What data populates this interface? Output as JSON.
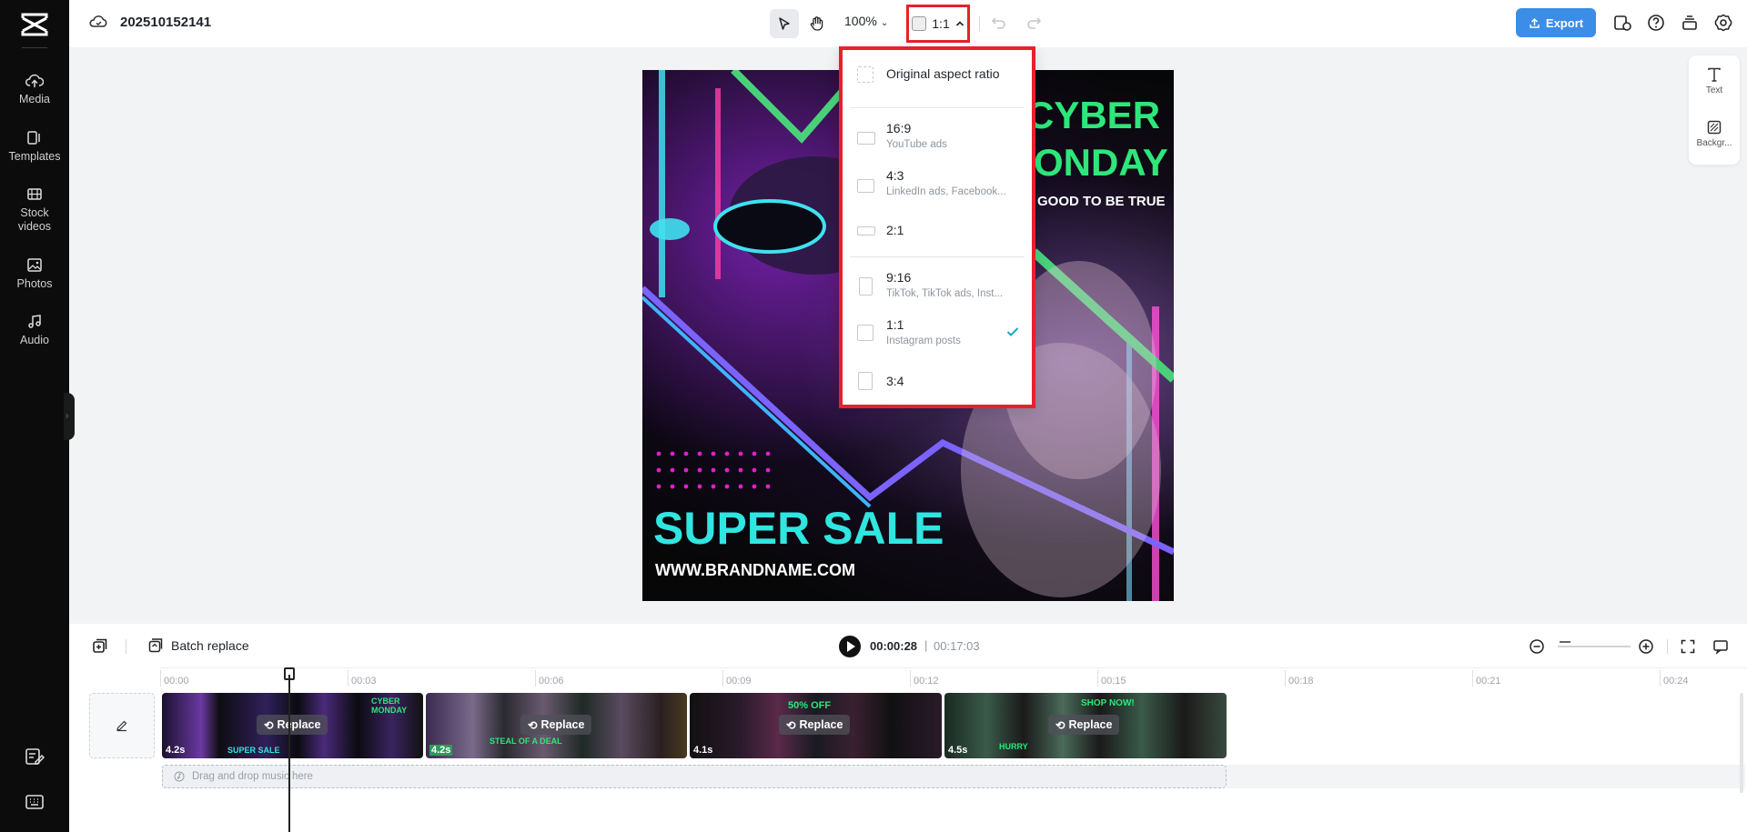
{
  "project": {
    "title": "202510152141"
  },
  "sidebar": {
    "items": [
      {
        "label": "Media",
        "icon": "cloud-upload-icon"
      },
      {
        "label": "Templates",
        "icon": "templates-icon"
      },
      {
        "label": "Stock\nvideos",
        "line1": "Stock",
        "line2": "videos",
        "icon": "stock-videos-icon"
      },
      {
        "label": "Photos",
        "icon": "photos-icon"
      },
      {
        "label": "Audio",
        "icon": "audio-icon"
      }
    ]
  },
  "toolbar": {
    "zoom": "100%",
    "ratio": "1:1",
    "export_label": "Export"
  },
  "right_panel": {
    "text_label": "Text",
    "background_label": "Backgr..."
  },
  "aspect_menu": {
    "items": [
      {
        "label": "Original aspect ratio",
        "sub": ""
      },
      {
        "label": "16:9",
        "sub": "YouTube ads"
      },
      {
        "label": "4:3",
        "sub": "LinkedIn ads, Facebook..."
      },
      {
        "label": "2:1",
        "sub": ""
      },
      {
        "label": "9:16",
        "sub": "TikTok, TikTok ads, Inst..."
      },
      {
        "label": "1:1",
        "sub": "Instagram posts",
        "selected": true
      },
      {
        "label": "3:4",
        "sub": ""
      }
    ]
  },
  "poster": {
    "headline1": "CYBER",
    "headline2": "ONDAY",
    "tagline": "GOOD TO BE TRUE",
    "sale": "SUPER SALE",
    "url": "WWW.BRANDNAME.COM"
  },
  "timeline": {
    "batch_replace": "Batch replace",
    "current_time": "00:00:28",
    "separator": "|",
    "total_time": "00:17:03",
    "ruler": [
      "00:00",
      "00:03",
      "00:06",
      "00:09",
      "00:12",
      "00:15",
      "00:18",
      "00:21",
      "00:24"
    ],
    "clips": [
      {
        "duration": "4.2s",
        "replace": "Replace",
        "t1": "CYBER MONDAY",
        "t2": "SUPER SALE"
      },
      {
        "duration": "4.2s",
        "replace": "Replace",
        "t1": "STEAL OF A DEAL",
        "t2": ""
      },
      {
        "duration": "4.1s",
        "replace": "Replace",
        "t1": "50% OFF",
        "t2": ""
      },
      {
        "duration": "4.5s",
        "replace": "Replace",
        "t1": "SHOP NOW!",
        "t2": "HURRY"
      }
    ],
    "music_placeholder": "Drag and drop music here"
  },
  "colors": {
    "accent": "#3b8de7",
    "highlight": "#e8202d",
    "check": "#1aa9c1",
    "neon_green": "#2ee67a",
    "neon_cyan": "#2fe6e0"
  }
}
